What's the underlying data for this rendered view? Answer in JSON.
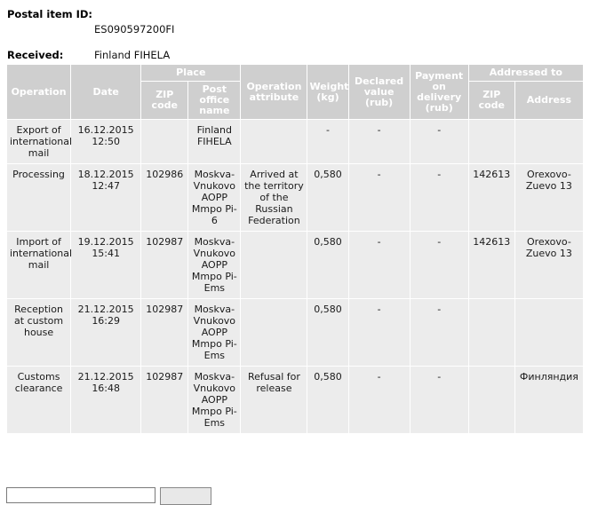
{
  "summary": {
    "item_id_label": "Postal item ID:",
    "item_id_value": "ES090597200FI",
    "received_label": "Received:",
    "received_value": "Finland FIHELA"
  },
  "table": {
    "group_headers": {
      "place": "Place",
      "addressed_to": "Addressed to"
    },
    "headers": {
      "operation": "Operation",
      "date": "Date",
      "zip_code": "ZIP code",
      "post_office_name": "Post office name",
      "operation_attribute": "Operation attribute",
      "weight": "Weight (kg)",
      "declared_value": "Declared value (rub)",
      "payment_on_delivery": "Payment on delivery (rub)",
      "addr_zip_code": "ZIP code",
      "address": "Address"
    },
    "rows": [
      {
        "operation": "Export of international mail",
        "date": "16.12.2015 12:50",
        "zip_code": "",
        "post_office_name": "Finland FIHELA",
        "operation_attribute": "",
        "weight": "-",
        "declared_value": "-",
        "payment_on_delivery": "-",
        "addr_zip_code": "",
        "address": "",
        "zip_is_link": false
      },
      {
        "operation": "Processing",
        "date": "18.12.2015 12:47",
        "zip_code": "102986",
        "post_office_name": "Moskva-Vnukovo AOPP Mmpo Pi-6",
        "operation_attribute": "Arrived at the territory of the Russian Federation",
        "weight": "0,580",
        "declared_value": "-",
        "payment_on_delivery": "-",
        "addr_zip_code": "142613",
        "address": "Orexovo-Zuevo 13",
        "zip_is_link": false
      },
      {
        "operation": "Import of international mail",
        "date": "19.12.2015 15:41",
        "zip_code": "102987",
        "post_office_name": "Moskva-Vnukovo AOPP Mmpo Pi-Ems",
        "operation_attribute": "",
        "weight": "0,580",
        "declared_value": "-",
        "payment_on_delivery": "-",
        "addr_zip_code": "142613",
        "address": "Orexovo-Zuevo 13",
        "zip_is_link": false
      },
      {
        "operation": "Reception at custom house",
        "date": "21.12.2015 16:29",
        "zip_code": "102987",
        "post_office_name": "Moskva-Vnukovo AOPP Mmpo Pi-Ems",
        "operation_attribute": "",
        "weight": "0,580",
        "declared_value": "-",
        "payment_on_delivery": "-",
        "addr_zip_code": "",
        "address": "",
        "zip_is_link": false
      },
      {
        "operation": "Customs clearance",
        "date": "21.12.2015 16:48",
        "zip_code": "102987",
        "post_office_name": "Moskva-Vnukovo AOPP Mmpo Pi-Ems",
        "operation_attribute": "Refusal for release",
        "weight": "0,580",
        "declared_value": "-",
        "payment_on_delivery": "-",
        "addr_zip_code": "",
        "address": "Финляндия",
        "zip_is_link": true
      }
    ]
  },
  "bottom_form": {
    "input_value": "",
    "input_placeholder": "",
    "button_label": ""
  },
  "colors": {
    "header_bg": "#cfcfcf",
    "header_text": "#ffffff",
    "cell_bg": "#ececec",
    "link": "#2b4fa0",
    "page_bg": "#ffffff"
  }
}
